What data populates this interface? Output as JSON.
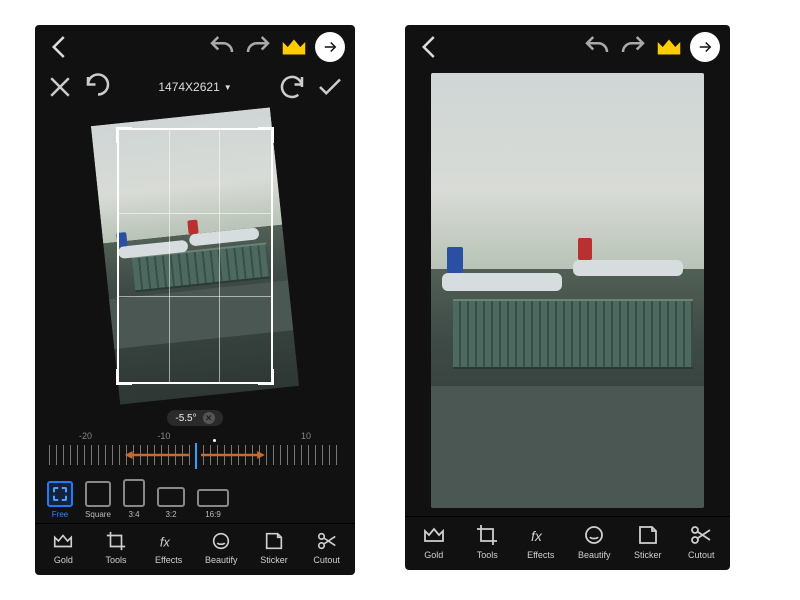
{
  "left": {
    "topbar": {
      "back": "back",
      "undo": "undo",
      "redo": "redo",
      "crown": "crown",
      "next": "next"
    },
    "subbar": {
      "close": "×",
      "reset": "reset",
      "dimensions": "1474X2621",
      "rotate": "rotate",
      "confirm": "✓"
    },
    "angle": {
      "value": "-5.5°"
    },
    "ruler": {
      "labels": [
        "-20",
        "-10",
        "",
        "10"
      ]
    },
    "ratios": [
      {
        "key": "free",
        "label": "Free"
      },
      {
        "key": "square",
        "label": "Square"
      },
      {
        "key": "r34",
        "label": "3:4"
      },
      {
        "key": "r32",
        "label": "3:2"
      },
      {
        "key": "r169",
        "label": "16:9"
      }
    ],
    "nav": [
      {
        "key": "gold",
        "label": "Gold"
      },
      {
        "key": "tools",
        "label": "Tools"
      },
      {
        "key": "effects",
        "label": "Effects"
      },
      {
        "key": "beautify",
        "label": "Beautify"
      },
      {
        "key": "sticker",
        "label": "Sticker"
      },
      {
        "key": "cutout",
        "label": "Cutout"
      }
    ]
  },
  "right": {
    "nav": [
      {
        "key": "gold",
        "label": "Gold"
      },
      {
        "key": "tools",
        "label": "Tools"
      },
      {
        "key": "effects",
        "label": "Effects"
      },
      {
        "key": "beautify",
        "label": "Beautify"
      },
      {
        "key": "sticker",
        "label": "Sticker"
      },
      {
        "key": "cutout",
        "label": "Cutout"
      }
    ]
  }
}
